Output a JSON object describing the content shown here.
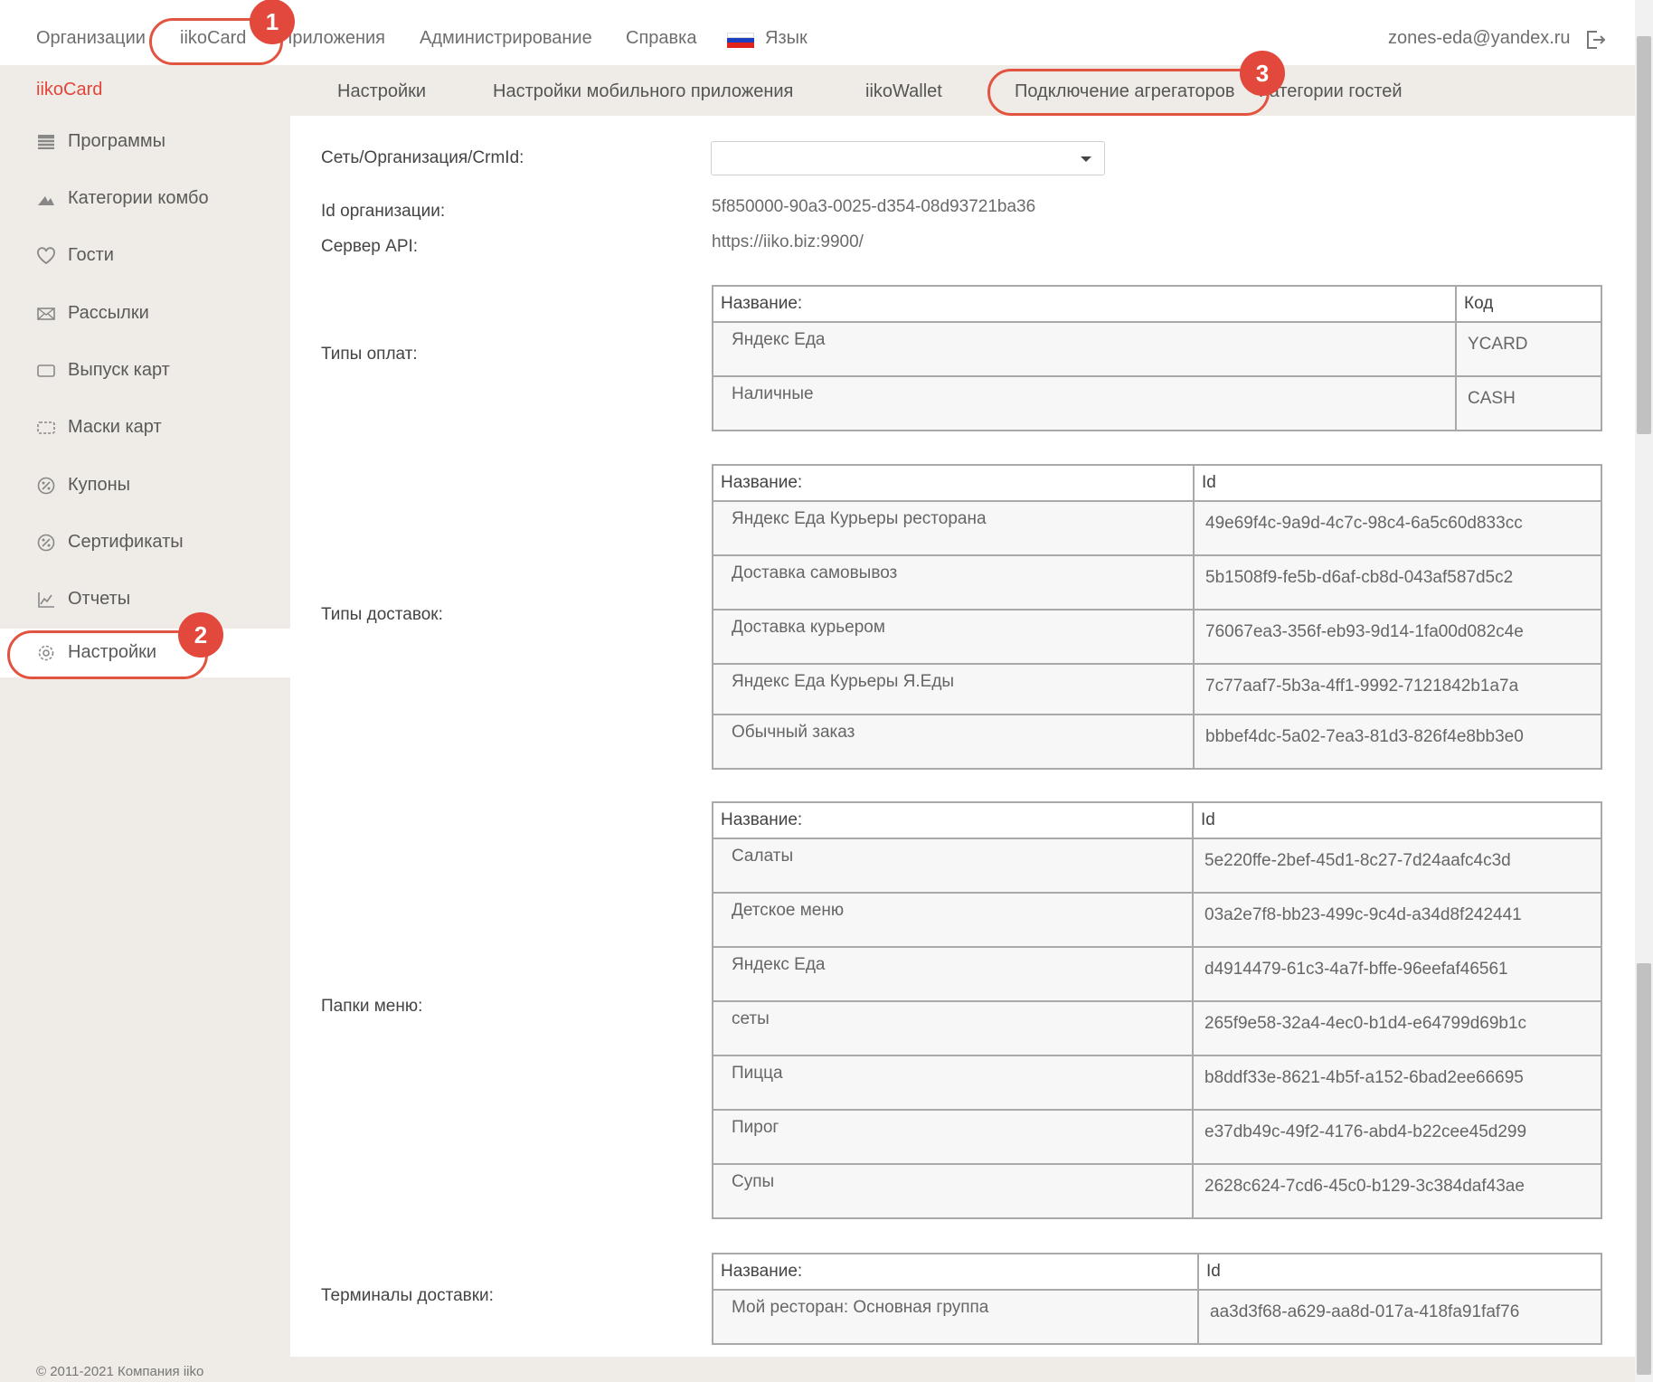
{
  "topnav": {
    "items": [
      "Организации",
      "iikoCard",
      "Приложения",
      "Администрирование",
      "Справка"
    ],
    "language_label": "Язык",
    "user_email": "zones-eda@yandex.ru"
  },
  "sidebar": {
    "brand": "iikoCard",
    "items": [
      {
        "label": "Программы",
        "icon": "list-icon"
      },
      {
        "label": "Категории комбо",
        "icon": "combo-icon"
      },
      {
        "label": "Гости",
        "icon": "heart-icon"
      },
      {
        "label": "Рассылки",
        "icon": "mail-icon"
      },
      {
        "label": "Выпуск карт",
        "icon": "card-icon"
      },
      {
        "label": "Маски карт",
        "icon": "card-mask-icon"
      },
      {
        "label": "Купоны",
        "icon": "coupon-icon"
      },
      {
        "label": "Сертификаты",
        "icon": "certificate-icon"
      },
      {
        "label": "Отчеты",
        "icon": "chart-icon"
      },
      {
        "label": "Настройки",
        "icon": "gear-icon"
      }
    ],
    "active": "Настройки"
  },
  "tabs": [
    "Настройки",
    "Настройки мобильного приложения",
    "iikoWallet",
    "Подключение агрегаторов",
    "Категории гостей"
  ],
  "active_tab": "Подключение агрегаторов",
  "form": {
    "network_label": "Сеть/Организация/CrmId:",
    "network_value": "",
    "org_id_label": "Id организации:",
    "org_id_value": "5f850000-90a3-0025-d354-08d93721ba36",
    "api_server_label": "Сервер API:",
    "api_server_value": "https://iiko.biz:9900/"
  },
  "payment_types": {
    "label": "Типы оплат:",
    "col_name": "Название:",
    "col_code": "Код",
    "rows": [
      {
        "name": "Яндекс Еда",
        "value": "YCARD"
      },
      {
        "name": "Наличные",
        "value": "CASH"
      }
    ]
  },
  "delivery_types": {
    "label": "Типы доставок:",
    "col_name": "Название:",
    "col_id": "Id",
    "rows": [
      {
        "name": "Яндекс Еда Курьеры ресторана",
        "value": "49e69f4c-9a9d-4c7c-98c4-6a5c60d833cc"
      },
      {
        "name": "Доставка самовывоз",
        "value": "5b1508f9-fe5b-d6af-cb8d-043af587d5c2"
      },
      {
        "name": "Доставка курьером",
        "value": "76067ea3-356f-eb93-9d14-1fa00d082c4e"
      },
      {
        "name": "Яндекс Еда Курьеры Я.Еды",
        "value": "7c77aaf7-5b3a-4ff1-9992-7121842b1a7a"
      },
      {
        "name": "Обычный заказ",
        "value": "bbbef4dc-5a02-7ea3-81d3-826f4e8bb3e0"
      }
    ]
  },
  "menu_folders": {
    "label": "Папки меню:",
    "col_name": "Название:",
    "col_id": "Id",
    "rows": [
      {
        "name": "Салаты",
        "value": "5e220ffe-2bef-45d1-8c27-7d24aafc4c3d"
      },
      {
        "name": "Детское меню",
        "value": "03a2e7f8-bb23-499c-9c4d-a34d8f242441"
      },
      {
        "name": "Яндекс Еда",
        "value": "d4914479-61c3-4a7f-bffe-96eefaf46561"
      },
      {
        "name": "сеты",
        "value": "265f9e58-32a4-4ec0-b1d4-e64799d69b1c"
      },
      {
        "name": "Пицца",
        "value": "b8ddf33e-8621-4b5f-a152-6bad2ee66695"
      },
      {
        "name": "Пирог",
        "value": "e37db49c-49f2-4176-abd4-b22cee45d299"
      },
      {
        "name": "Супы",
        "value": "2628c624-7cd6-45c0-b129-3c384daf43ae"
      }
    ]
  },
  "delivery_terminals": {
    "label": "Терминалы доставки:",
    "col_name": "Название:",
    "col_id": "Id",
    "rows": [
      {
        "name": "Мой ресторан: Основная группа",
        "value": "aa3d3f68-a629-aa8d-017a-418fa91faf76"
      }
    ]
  },
  "footer": "© 2011-2021 Компания iiko",
  "annotations": [
    "1",
    "2",
    "3"
  ],
  "colors": {
    "accent": "#e2463a",
    "sidebar_bg": "#efebe6",
    "table_border": "#a9a9a9"
  }
}
